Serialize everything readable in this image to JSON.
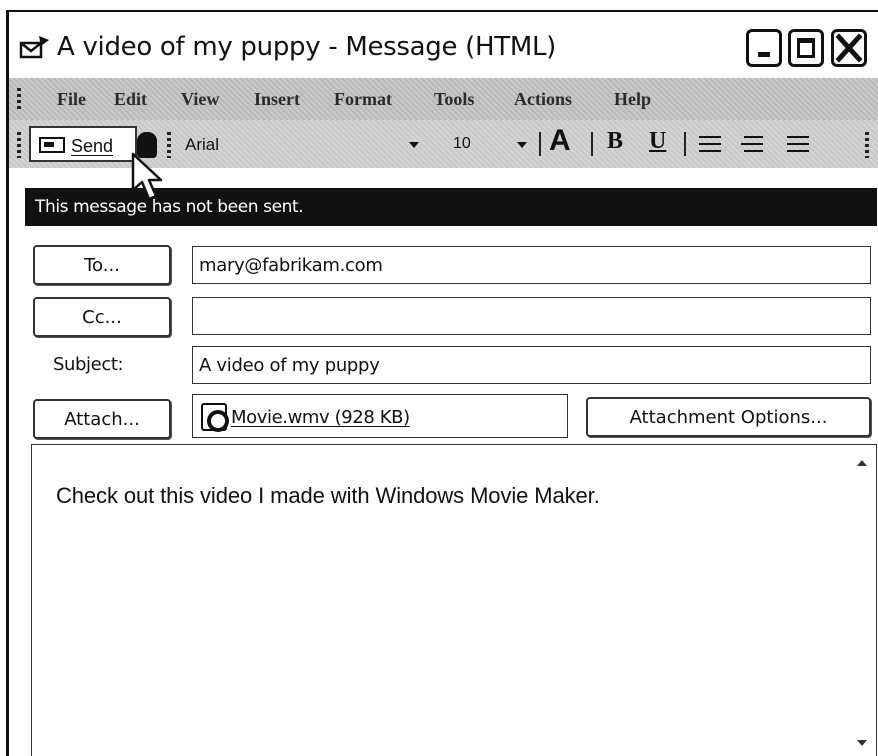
{
  "window": {
    "title": "A video of my puppy - Message (HTML)"
  },
  "menubar": {
    "items": [
      "File",
      "Edit",
      "View",
      "Insert",
      "Format",
      "Tools",
      "Actions",
      "Help"
    ]
  },
  "toolbar": {
    "send_label": "Send",
    "font_name": "Arial",
    "font_size": "10",
    "font_color_label": "A",
    "bold_label": "B",
    "underline_label": "U"
  },
  "notice": {
    "text": "This message has not been sent."
  },
  "header": {
    "to_button": "To...",
    "to_value": "mary@fabrikam.com",
    "cc_button": "Cc...",
    "cc_value": "",
    "subject_label": "Subject:",
    "subject_value": "A video of my puppy",
    "attach_button": "Attach...",
    "attachment_file": "Movie.wmv (928 KB)",
    "attachment_options_button": "Attachment Options..."
  },
  "body": {
    "text": "Check out this video I made with Windows Movie Maker."
  },
  "icons": {
    "title": "envelope-icon",
    "send": "send-icon",
    "help": "help-icon",
    "attachment": "video-file-icon"
  }
}
